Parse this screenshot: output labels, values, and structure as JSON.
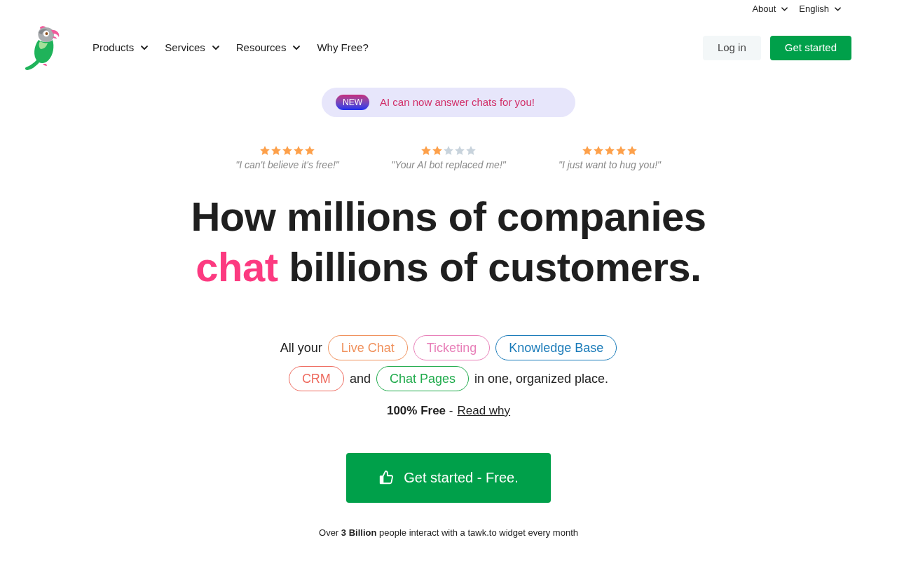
{
  "top_links": [
    {
      "label": "About",
      "dropdown": true
    },
    {
      "label": "English",
      "dropdown": true
    }
  ],
  "nav": {
    "items": [
      {
        "label": "Products",
        "dropdown": true
      },
      {
        "label": "Services",
        "dropdown": true
      },
      {
        "label": "Resources",
        "dropdown": true
      },
      {
        "label": "Why Free?",
        "dropdown": false
      }
    ],
    "login": "Log in",
    "cta": "Get started"
  },
  "announcement": {
    "badge": "NEW",
    "text": "AI can now answer chats for you!"
  },
  "reviews": [
    {
      "stars": 5,
      "quote": "\"I can't believe it's free!\""
    },
    {
      "stars": 2,
      "quote": "\"Your AI bot replaced me!\""
    },
    {
      "stars": 5,
      "quote": "\"I just want to hug you!\""
    }
  ],
  "headline": {
    "line_1": "How millions of companies",
    "highlight": "chat",
    "line_2": "billions of customers."
  },
  "feature_lines": [
    [
      {
        "kind": "text",
        "text": "All your"
      },
      {
        "kind": "tag",
        "text": "Live Chat",
        "color": "#f0915c"
      },
      {
        "kind": "tag",
        "text": "Ticketing",
        "color": "#e87fb8"
      },
      {
        "kind": "tag",
        "text": "Knowledge Base",
        "color": "#1a7bb9"
      }
    ],
    [
      {
        "kind": "tag",
        "text": "CRM",
        "color": "#ee6b5f"
      },
      {
        "kind": "text",
        "text": "and"
      },
      {
        "kind": "tag",
        "text": "Chat Pages",
        "color": "#20ab4c"
      },
      {
        "kind": "text",
        "text": "in one, organized place."
      }
    ]
  ],
  "free_note": {
    "text": "**100% Free** -",
    "link": "Read why"
  },
  "cta": {
    "label": "Get started - Free."
  },
  "footnote": "Over **3 Billion** people interact with a tawk.to widget every month"
}
